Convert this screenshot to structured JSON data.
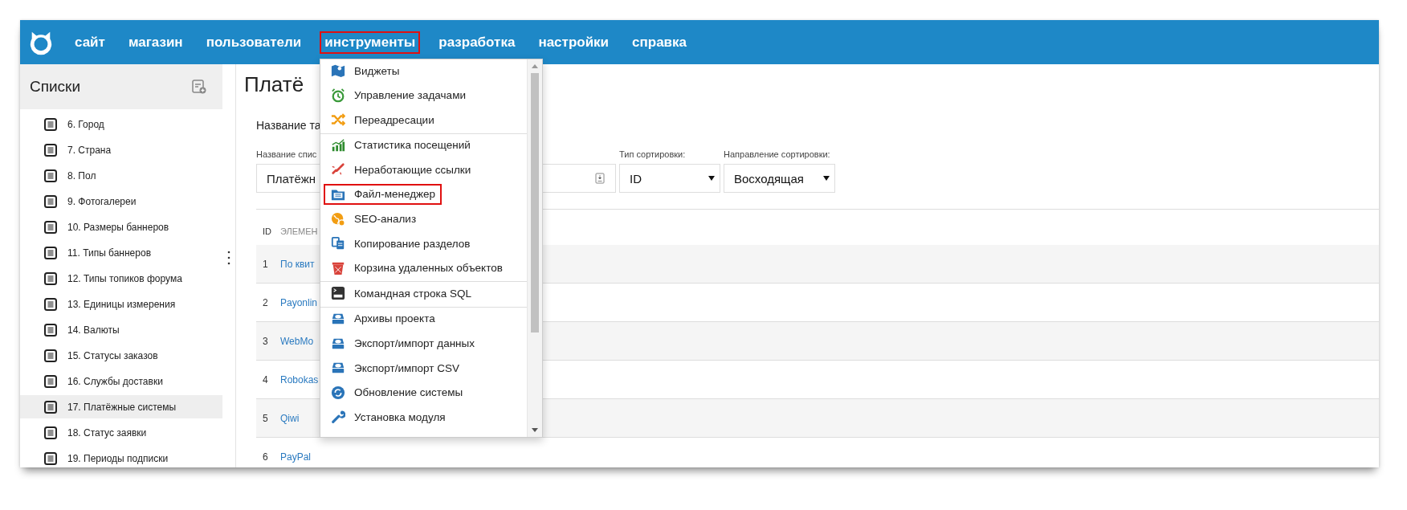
{
  "nav": {
    "items": [
      {
        "label": "сайт",
        "annotated": false
      },
      {
        "label": "магазин",
        "annotated": false
      },
      {
        "label": "пользователи",
        "annotated": false
      },
      {
        "label": "инструменты",
        "annotated": true
      },
      {
        "label": "разработка",
        "annotated": false
      },
      {
        "label": "настройки",
        "annotated": false
      },
      {
        "label": "справка",
        "annotated": false
      }
    ]
  },
  "sidebar": {
    "title": "Списки",
    "items": [
      {
        "label": "6. Город",
        "selected": false
      },
      {
        "label": "7. Страна",
        "selected": false
      },
      {
        "label": "8. Пол",
        "selected": false
      },
      {
        "label": "9. Фотогалереи",
        "selected": false
      },
      {
        "label": "10. Размеры баннеров",
        "selected": false
      },
      {
        "label": "11. Типы баннеров",
        "selected": false
      },
      {
        "label": "12. Типы топиков форума",
        "selected": false
      },
      {
        "label": "13. Единицы измерения",
        "selected": false
      },
      {
        "label": "14. Валюты",
        "selected": false
      },
      {
        "label": "15. Статусы заказов",
        "selected": false
      },
      {
        "label": "16. Службы доставки",
        "selected": false
      },
      {
        "label": "17. Платёжные системы",
        "selected": true
      },
      {
        "label": "18. Статус заявки",
        "selected": false
      },
      {
        "label": "19. Периоды подписки",
        "selected": false
      }
    ]
  },
  "main": {
    "title": "Платё",
    "table_name_label": "Название та",
    "list_name": {
      "label": "Название спис",
      "value": "Платёжн"
    },
    "sort_type": {
      "label": "Тип сортировки:",
      "value": "ID"
    },
    "sort_direction": {
      "label": "Направление сортировки:",
      "value": "Восходящая"
    },
    "table": {
      "columns": [
        "ID",
        "ЭЛЕМЕН"
      ],
      "rows": [
        {
          "id": "1",
          "name": "По квит"
        },
        {
          "id": "2",
          "name": "Payonlin"
        },
        {
          "id": "3",
          "name": "WebMo"
        },
        {
          "id": "4",
          "name": "Robokas"
        },
        {
          "id": "5",
          "name": "Qiwi"
        },
        {
          "id": "6",
          "name": "PayPal"
        }
      ]
    }
  },
  "menu": {
    "groups": [
      [
        {
          "label": "Виджеты",
          "annotated": false
        },
        {
          "label": "Управление задачами",
          "annotated": false
        },
        {
          "label": "Переадресации",
          "annotated": false
        }
      ],
      [
        {
          "label": "Статистика посещений",
          "annotated": false
        },
        {
          "label": "Неработающие ссылки",
          "annotated": false
        },
        {
          "label": "Файл-менеджер",
          "annotated": true
        },
        {
          "label": "SEO-анализ",
          "annotated": false
        },
        {
          "label": "Копирование разделов",
          "annotated": false
        },
        {
          "label": "Корзина удаленных объектов",
          "annotated": false
        }
      ],
      [
        {
          "label": "Командная строка SQL",
          "annotated": false
        }
      ],
      [
        {
          "label": "Архивы проекта",
          "annotated": false
        },
        {
          "label": "Экспорт/импорт данных",
          "annotated": false
        },
        {
          "label": "Экспорт/импорт CSV",
          "annotated": false
        },
        {
          "label": "Обновление системы",
          "annotated": false
        },
        {
          "label": "Установка модуля",
          "annotated": false
        }
      ]
    ]
  }
}
